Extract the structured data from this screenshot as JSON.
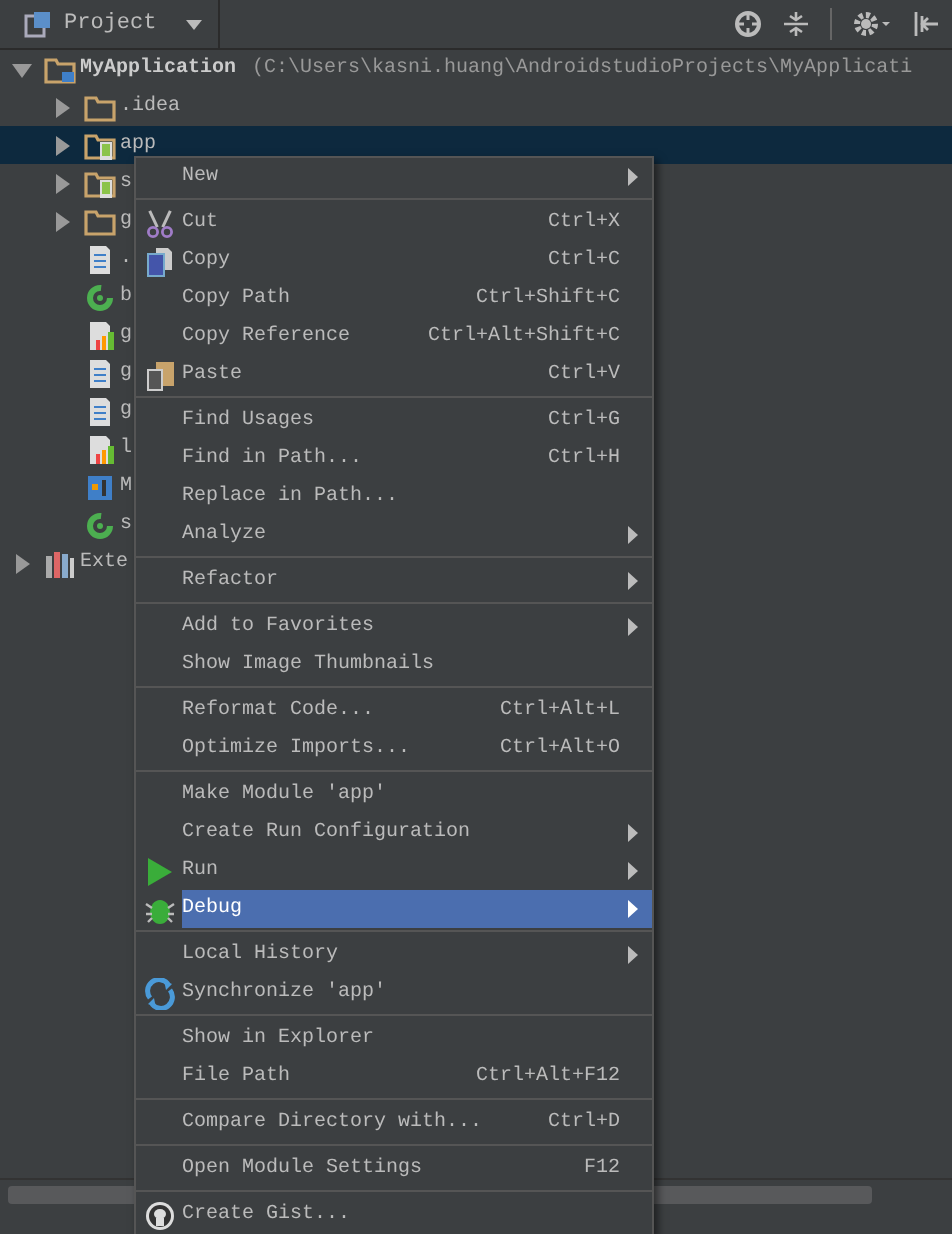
{
  "panel": {
    "title": "Project"
  },
  "tree": [
    {
      "label": "MyApplication",
      "detail": "(C:\\Users\\kasni.huang\\AndroidstudioProjects\\MyApplicati",
      "kind": "project",
      "expanded": true,
      "selected": false,
      "children": [
        {
          "label": ".idea",
          "kind": "folder",
          "expanded": false,
          "selected": false
        },
        {
          "label": "app",
          "kind": "module",
          "expanded": false,
          "selected": true
        },
        {
          "label": "s",
          "kind": "module",
          "expanded": false,
          "selected": false
        },
        {
          "label": "g",
          "kind": "folder",
          "expanded": false,
          "selected": false
        },
        {
          "label": ".",
          "kind": "file",
          "selected": false
        },
        {
          "label": "b",
          "kind": "gradle",
          "selected": false
        },
        {
          "label": "g",
          "kind": "chartfile",
          "selected": false
        },
        {
          "label": "g",
          "kind": "file",
          "selected": false
        },
        {
          "label": "g",
          "kind": "file",
          "selected": false
        },
        {
          "label": "l",
          "kind": "chartfile",
          "selected": false
        },
        {
          "label": "M",
          "kind": "iml",
          "selected": false
        },
        {
          "label": "s",
          "kind": "gradle",
          "selected": false
        }
      ]
    },
    {
      "label": "Exte",
      "kind": "library",
      "expanded": false,
      "selected": false
    }
  ],
  "context_menu": {
    "groups": [
      [
        {
          "label": "New",
          "submenu": true,
          "selected": false
        }
      ],
      [
        {
          "label": "Cut",
          "shortcut": "Ctrl+X",
          "kind": "cut",
          "selected": false
        },
        {
          "label": "Copy",
          "shortcut": "Ctrl+C",
          "kind": "copy",
          "selected": false
        },
        {
          "label": "Copy Path",
          "shortcut": "Ctrl+Shift+C",
          "selected": false
        },
        {
          "label": "Copy Reference",
          "shortcut": "Ctrl+Alt+Shift+C",
          "selected": false
        },
        {
          "label": "Paste",
          "shortcut": "Ctrl+V",
          "kind": "paste",
          "selected": false
        }
      ],
      [
        {
          "label": "Find Usages",
          "shortcut": "Ctrl+G",
          "selected": false
        },
        {
          "label": "Find in Path...",
          "shortcut": "Ctrl+H",
          "selected": false
        },
        {
          "label": "Replace in Path...",
          "selected": false
        },
        {
          "label": "Analyze",
          "submenu": true,
          "selected": false
        }
      ],
      [
        {
          "label": "Refactor",
          "submenu": true,
          "selected": false
        }
      ],
      [
        {
          "label": "Add to Favorites",
          "submenu": true,
          "selected": false
        },
        {
          "label": "Show Image Thumbnails",
          "selected": false
        }
      ],
      [
        {
          "label": "Reformat Code...",
          "shortcut": "Ctrl+Alt+L",
          "selected": false
        },
        {
          "label": "Optimize Imports...",
          "shortcut": "Ctrl+Alt+O",
          "selected": false
        }
      ],
      [
        {
          "label": "Make Module 'app'",
          "selected": false
        },
        {
          "label": "Create Run Configuration",
          "submenu": true,
          "selected": false
        },
        {
          "label": "Run",
          "submenu": true,
          "kind": "run",
          "selected": false
        },
        {
          "label": "Debug",
          "submenu": true,
          "kind": "debug",
          "selected": true
        }
      ],
      [
        {
          "label": "Local History",
          "submenu": true,
          "selected": false
        },
        {
          "label": "Synchronize 'app'",
          "kind": "sync",
          "selected": false
        }
      ],
      [
        {
          "label": "Show in Explorer",
          "selected": false
        },
        {
          "label": "File Path",
          "shortcut": "Ctrl+Alt+F12",
          "selected": false
        }
      ],
      [
        {
          "label": "Compare Directory with...",
          "shortcut": "Ctrl+D",
          "selected": false
        }
      ],
      [
        {
          "label": "Open Module Settings",
          "shortcut": "F12",
          "selected": false
        }
      ],
      [
        {
          "label": "Create Gist...",
          "kind": "github",
          "selected": false
        }
      ]
    ]
  }
}
